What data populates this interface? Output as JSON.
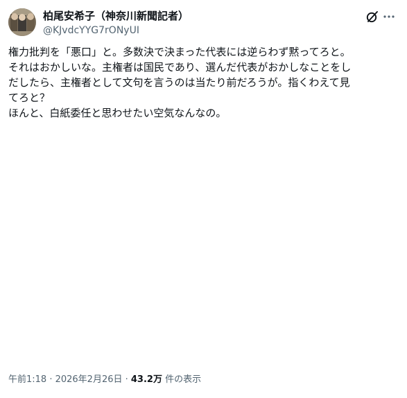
{
  "author": {
    "display_name": "柏尾安希子（神奈川新聞記者）",
    "handle": "@KJvdcYYG7rONyUI"
  },
  "header_icons": [
    "grok-icon",
    "more-icon"
  ],
  "tweet": {
    "lines": [
      "権力批判を「悪口」と。多数決で決まった代表には逆らわず黙ってろと。",
      "それはおかしいな。主権者は国民であり、選んだ代表がおかしなことをし",
      "だしたら、主権者として文句を言うのは当たり前だろうが。指くわえて見",
      "てろと？",
      "ほんと、白紙委任と思わせたい空気なんなの。"
    ]
  },
  "meta": {
    "timestamp": "午前1:18 · 2026年2月26日 · ",
    "views_count": "43.2万",
    "views_label": " 件の表示"
  },
  "colors": {
    "text_primary": "#0f1419",
    "text_secondary": "#536471",
    "background": "#ffffff"
  }
}
